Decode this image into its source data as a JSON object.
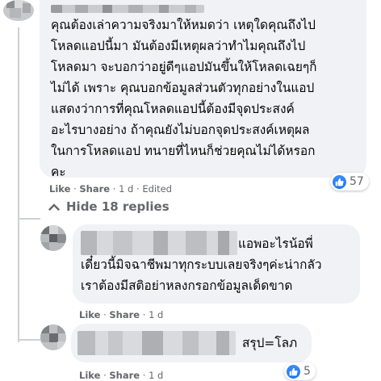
{
  "comments": [
    {
      "text": "คุณต้องเล่าความจริงมาให้หมดว่า เหตุใดคุณถึงไป\nโหลดแอปนี้มา มันต้องมีเหตุผลว่าทำไมคุณถึงไป\nโหลดมา จะบอกว่าอยู่ดีๆแอปมันขึ้นให้โหลดเฉยๆก็\nไม่ได้ เพราะ คุณบอกข้อมูลส่วนตัวทุกอย่างในแอป\nแสดงว่าการที่คุณโหลดแอปนี้ต้องมีจุดประสงค์\nอะไรบางอย่าง ถ้าคุณยังไม่บอกจุดประสงค์เหตุผล\nในการโหลดแอป ทนายที่ไหนก็ช่วยคุณไม่ได้หรอก\nคะ",
      "like": "Like",
      "share": "Share",
      "time": "1 d",
      "edited": "Edited",
      "reaction_count": "57"
    }
  ],
  "hide_replies_label": "Hide 18 replies",
  "replies": [
    {
      "text": "แอพอะไรน้อพี่\nเดี๋ยวนี้มิจฉาชีพมาทุกระบบเลยจริงๆค่ะน่ากลัว\nเราต้องมีสติอย่าหลงกรอกข้อมูลเด็ดขาด",
      "like": "Like",
      "share": "Share",
      "time": "1 d"
    },
    {
      "text": "สรุป=โลภ",
      "like": "Like",
      "share": "Share",
      "time": "1 d",
      "reaction_count": "5"
    }
  ],
  "colors": {
    "bubble": "#f0f2f5",
    "meta": "#65676b",
    "like_blue": "#1877f2"
  }
}
